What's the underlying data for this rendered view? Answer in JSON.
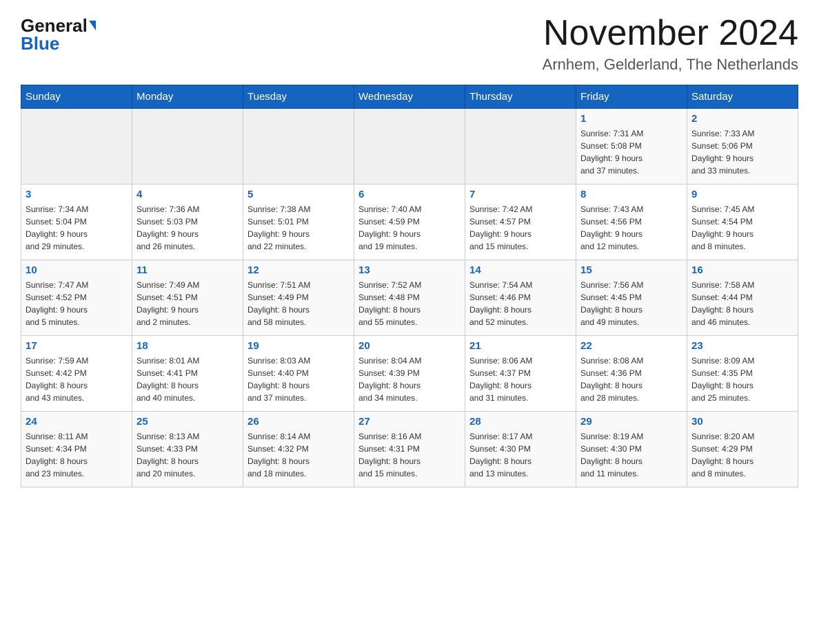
{
  "header": {
    "logo_general": "General",
    "logo_blue": "Blue",
    "title": "November 2024",
    "subtitle": "Arnhem, Gelderland, The Netherlands"
  },
  "days_of_week": [
    "Sunday",
    "Monday",
    "Tuesday",
    "Wednesday",
    "Thursday",
    "Friday",
    "Saturday"
  ],
  "weeks": [
    [
      {
        "day": "",
        "info": ""
      },
      {
        "day": "",
        "info": ""
      },
      {
        "day": "",
        "info": ""
      },
      {
        "day": "",
        "info": ""
      },
      {
        "day": "",
        "info": ""
      },
      {
        "day": "1",
        "info": "Sunrise: 7:31 AM\nSunset: 5:08 PM\nDaylight: 9 hours\nand 37 minutes."
      },
      {
        "day": "2",
        "info": "Sunrise: 7:33 AM\nSunset: 5:06 PM\nDaylight: 9 hours\nand 33 minutes."
      }
    ],
    [
      {
        "day": "3",
        "info": "Sunrise: 7:34 AM\nSunset: 5:04 PM\nDaylight: 9 hours\nand 29 minutes."
      },
      {
        "day": "4",
        "info": "Sunrise: 7:36 AM\nSunset: 5:03 PM\nDaylight: 9 hours\nand 26 minutes."
      },
      {
        "day": "5",
        "info": "Sunrise: 7:38 AM\nSunset: 5:01 PM\nDaylight: 9 hours\nand 22 minutes."
      },
      {
        "day": "6",
        "info": "Sunrise: 7:40 AM\nSunset: 4:59 PM\nDaylight: 9 hours\nand 19 minutes."
      },
      {
        "day": "7",
        "info": "Sunrise: 7:42 AM\nSunset: 4:57 PM\nDaylight: 9 hours\nand 15 minutes."
      },
      {
        "day": "8",
        "info": "Sunrise: 7:43 AM\nSunset: 4:56 PM\nDaylight: 9 hours\nand 12 minutes."
      },
      {
        "day": "9",
        "info": "Sunrise: 7:45 AM\nSunset: 4:54 PM\nDaylight: 9 hours\nand 8 minutes."
      }
    ],
    [
      {
        "day": "10",
        "info": "Sunrise: 7:47 AM\nSunset: 4:52 PM\nDaylight: 9 hours\nand 5 minutes."
      },
      {
        "day": "11",
        "info": "Sunrise: 7:49 AM\nSunset: 4:51 PM\nDaylight: 9 hours\nand 2 minutes."
      },
      {
        "day": "12",
        "info": "Sunrise: 7:51 AM\nSunset: 4:49 PM\nDaylight: 8 hours\nand 58 minutes."
      },
      {
        "day": "13",
        "info": "Sunrise: 7:52 AM\nSunset: 4:48 PM\nDaylight: 8 hours\nand 55 minutes."
      },
      {
        "day": "14",
        "info": "Sunrise: 7:54 AM\nSunset: 4:46 PM\nDaylight: 8 hours\nand 52 minutes."
      },
      {
        "day": "15",
        "info": "Sunrise: 7:56 AM\nSunset: 4:45 PM\nDaylight: 8 hours\nand 49 minutes."
      },
      {
        "day": "16",
        "info": "Sunrise: 7:58 AM\nSunset: 4:44 PM\nDaylight: 8 hours\nand 46 minutes."
      }
    ],
    [
      {
        "day": "17",
        "info": "Sunrise: 7:59 AM\nSunset: 4:42 PM\nDaylight: 8 hours\nand 43 minutes."
      },
      {
        "day": "18",
        "info": "Sunrise: 8:01 AM\nSunset: 4:41 PM\nDaylight: 8 hours\nand 40 minutes."
      },
      {
        "day": "19",
        "info": "Sunrise: 8:03 AM\nSunset: 4:40 PM\nDaylight: 8 hours\nand 37 minutes."
      },
      {
        "day": "20",
        "info": "Sunrise: 8:04 AM\nSunset: 4:39 PM\nDaylight: 8 hours\nand 34 minutes."
      },
      {
        "day": "21",
        "info": "Sunrise: 8:06 AM\nSunset: 4:37 PM\nDaylight: 8 hours\nand 31 minutes."
      },
      {
        "day": "22",
        "info": "Sunrise: 8:08 AM\nSunset: 4:36 PM\nDaylight: 8 hours\nand 28 minutes."
      },
      {
        "day": "23",
        "info": "Sunrise: 8:09 AM\nSunset: 4:35 PM\nDaylight: 8 hours\nand 25 minutes."
      }
    ],
    [
      {
        "day": "24",
        "info": "Sunrise: 8:11 AM\nSunset: 4:34 PM\nDaylight: 8 hours\nand 23 minutes."
      },
      {
        "day": "25",
        "info": "Sunrise: 8:13 AM\nSunset: 4:33 PM\nDaylight: 8 hours\nand 20 minutes."
      },
      {
        "day": "26",
        "info": "Sunrise: 8:14 AM\nSunset: 4:32 PM\nDaylight: 8 hours\nand 18 minutes."
      },
      {
        "day": "27",
        "info": "Sunrise: 8:16 AM\nSunset: 4:31 PM\nDaylight: 8 hours\nand 15 minutes."
      },
      {
        "day": "28",
        "info": "Sunrise: 8:17 AM\nSunset: 4:30 PM\nDaylight: 8 hours\nand 13 minutes."
      },
      {
        "day": "29",
        "info": "Sunrise: 8:19 AM\nSunset: 4:30 PM\nDaylight: 8 hours\nand 11 minutes."
      },
      {
        "day": "30",
        "info": "Sunrise: 8:20 AM\nSunset: 4:29 PM\nDaylight: 8 hours\nand 8 minutes."
      }
    ]
  ]
}
